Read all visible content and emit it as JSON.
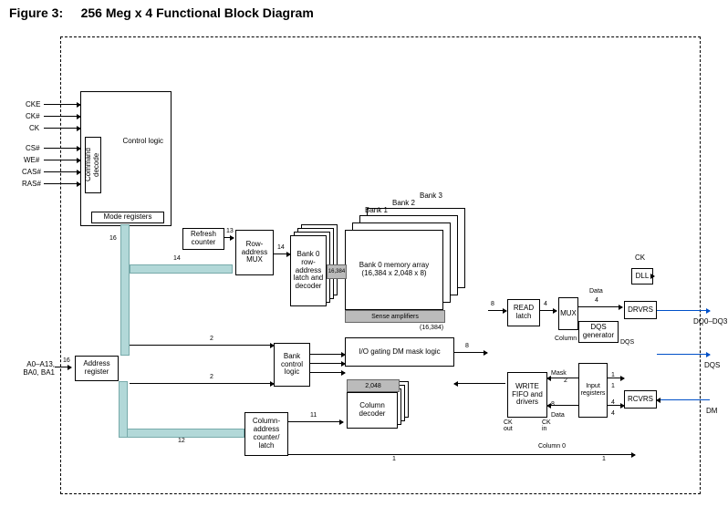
{
  "figure": {
    "label": "Figure 3:",
    "title": "256 Meg x 4 Functional Block Diagram"
  },
  "pins_left_top": [
    "CKE",
    "CK#",
    "CK",
    "CS#",
    "WE#",
    "CAS#",
    "RAS#"
  ],
  "pins_left_mid": {
    "addr": "A0–A13,\nBA0, BA1",
    "width": "16"
  },
  "pins_right": {
    "ck": "CK",
    "dq": "DQ0–DQ3",
    "dqs": "DQS",
    "dm": "DM"
  },
  "blocks": {
    "control_logic": "Control\nlogic",
    "command_decode": "Command\ndecode",
    "mode_registers": "Mode registers",
    "refresh_counter": "Refresh\ncounter",
    "row_addr_mux": "Row-\naddress\nMUX",
    "row_latch": "Bank 0\nrow-\naddress\nlatch\nand\ndecoder",
    "memory_array": "Bank 0\nmemory\narray\n(16,384 x 2,048 x 8)",
    "sense_amps": "Sense amplifiers",
    "io_gating": "I/O gating\nDM mask logic",
    "bank_control": "Bank\ncontrol\nlogic",
    "column_decoder": "Column\ndecoder",
    "col_addr_latch": "Column-\naddress\ncounter/\nlatch",
    "address_register": "Address\nregister",
    "read_latch": "READ\nlatch",
    "mux": "MUX",
    "dqs_gen": "DQS\ngenerator",
    "drvrs": "DRVRS",
    "dll": "DLL",
    "write_fifo": "WRITE\nFIFO\nand\ndrivers",
    "input_registers": "Input\nregisters",
    "rcvrs": "RCVRS"
  },
  "bank_labels": [
    "Bank 1",
    "Bank 2",
    "Bank 3"
  ],
  "wire_widths": {
    "row_mux_out": "14",
    "refresh_to_mux": "13",
    "addr_to_mux": "14",
    "col_latch_out": "11",
    "addr_to_col": "12",
    "mode_to_addr": "16",
    "bank_sel": "2",
    "bank_sel2": "2",
    "sense_width": "(16,384)",
    "io_width": "16,384",
    "io_out": "8",
    "io_narrow": "8",
    "read_to_mux": "4",
    "mux_to_drv": "4",
    "mask": "Mask",
    "data": "Data",
    "col0": "Column 0",
    "col0b": "Column 0",
    "ck_out": "CK\nout",
    "ck_in": "CK\nin",
    "one": "1",
    "two": "2",
    "four": "4",
    "dqs": "DQS",
    "col_2048": "2,048"
  }
}
